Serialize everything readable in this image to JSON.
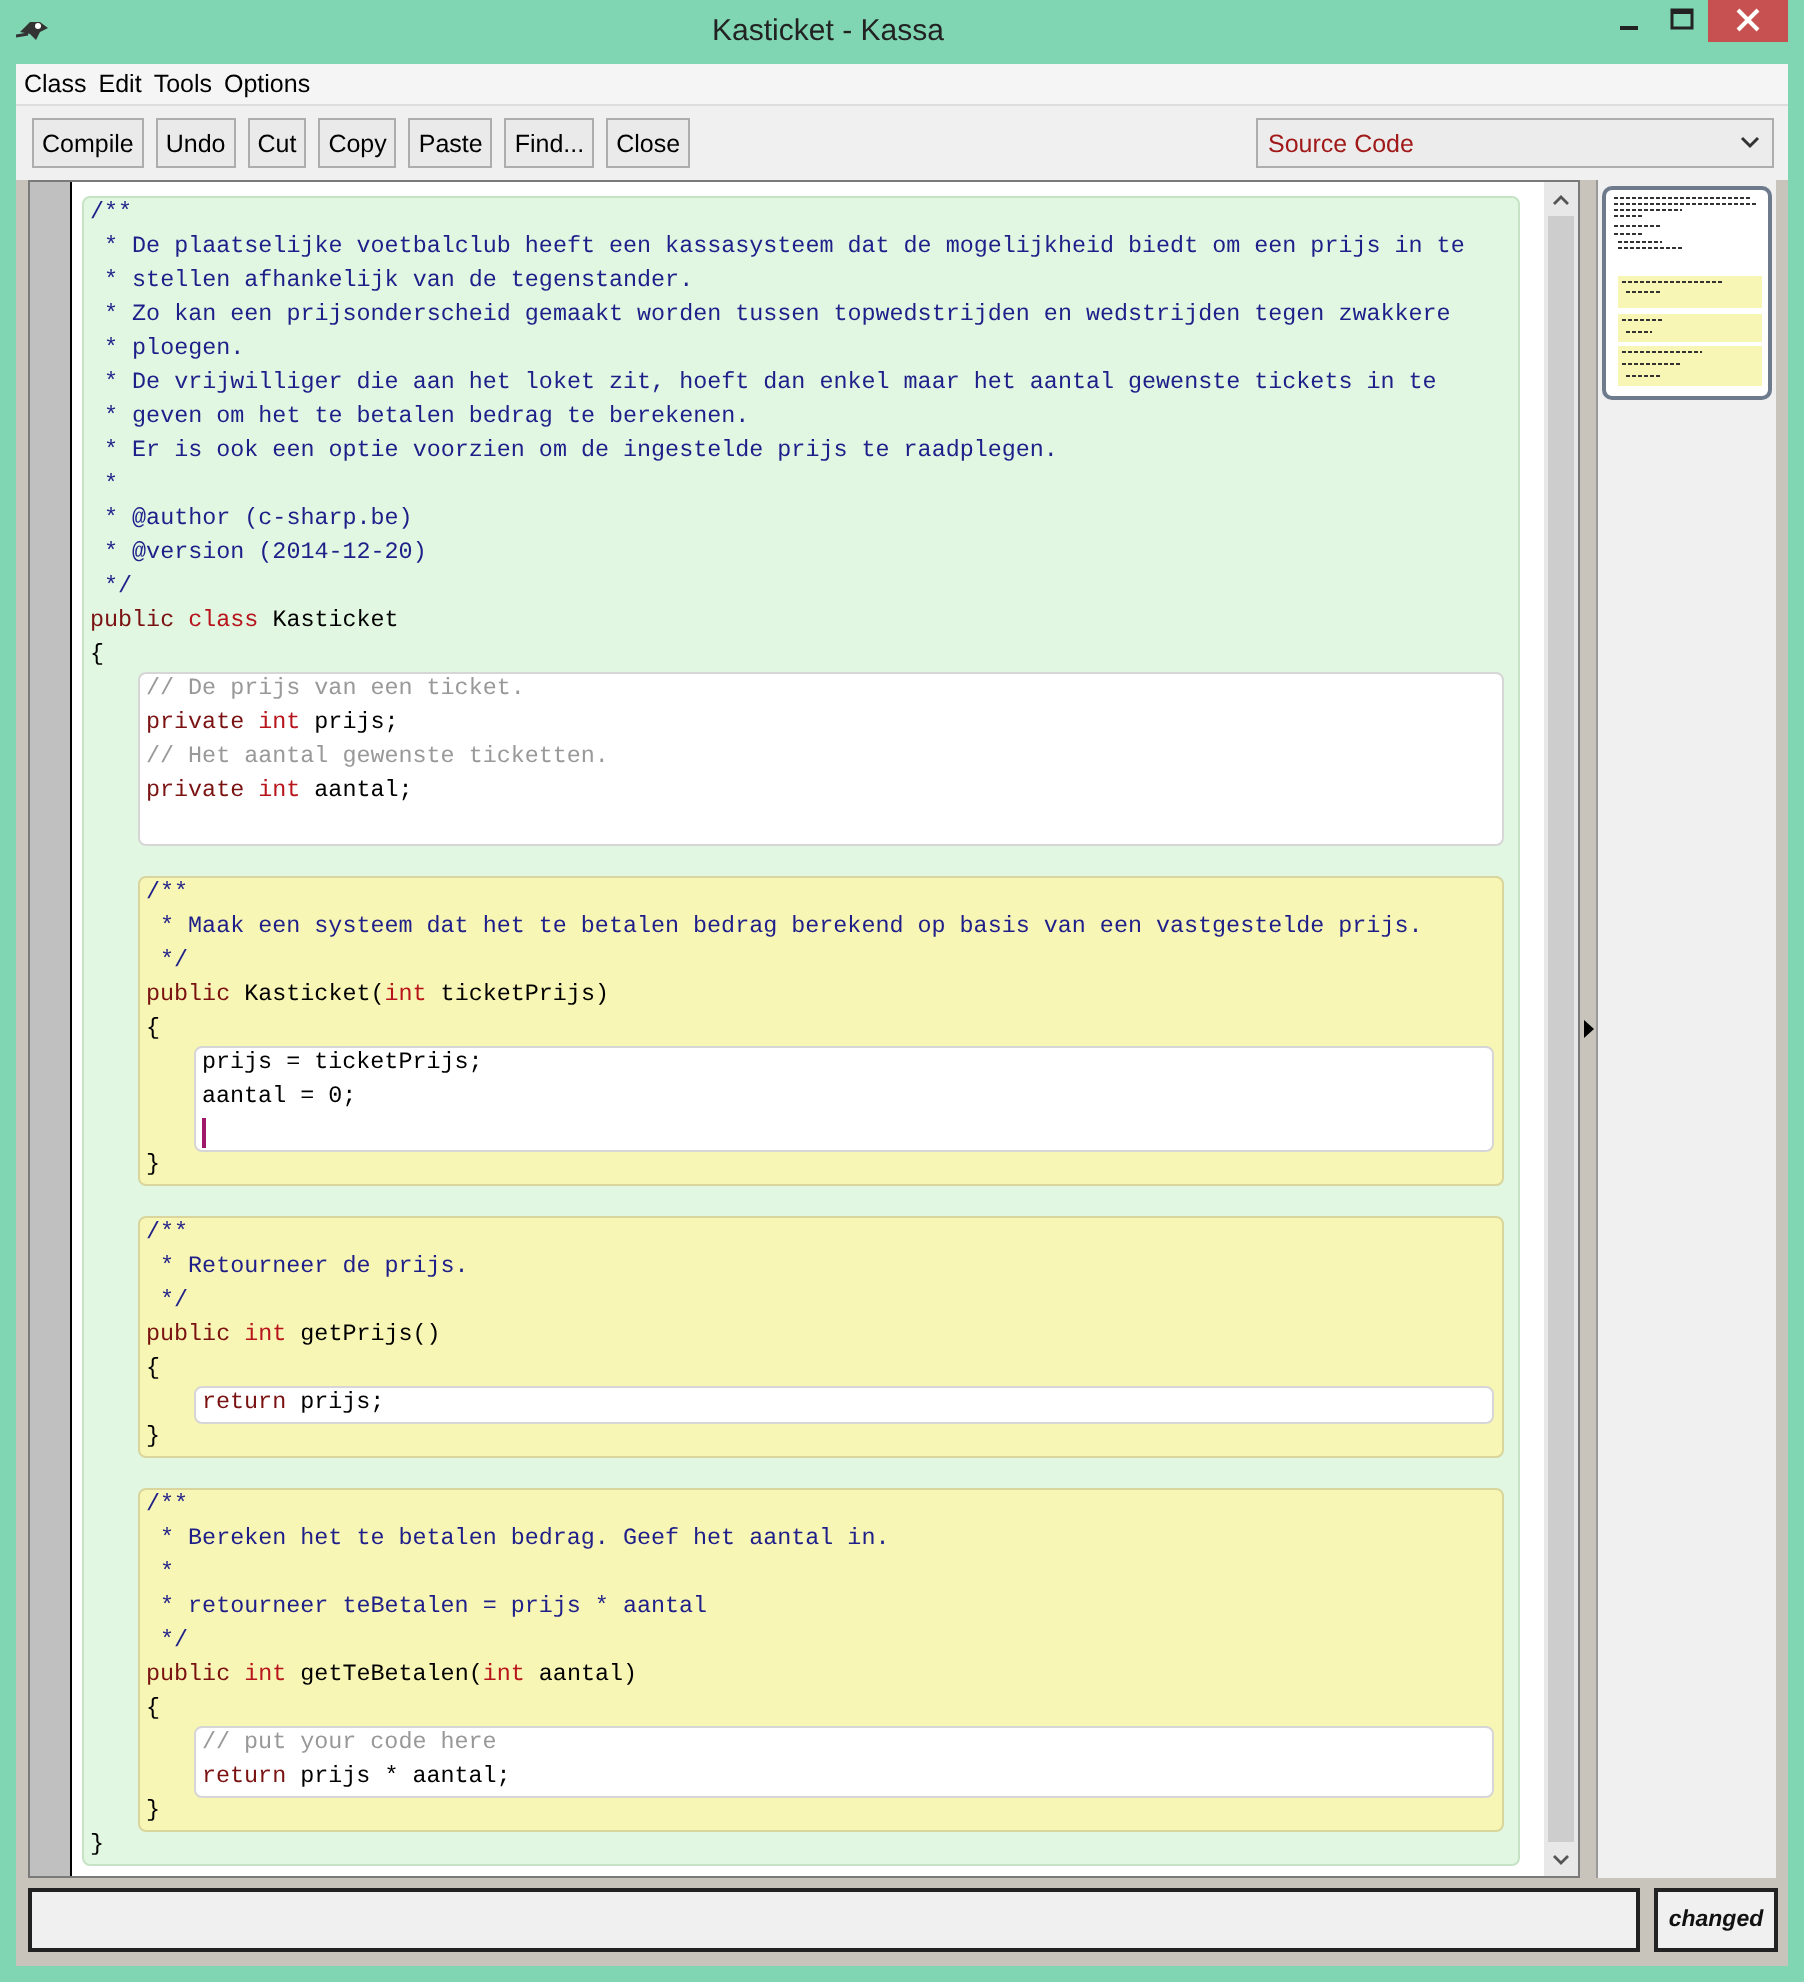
{
  "window": {
    "title": "Kasticket - Kassa"
  },
  "menu": [
    "Class",
    "Edit",
    "Tools",
    "Options"
  ],
  "toolbar": {
    "buttons": [
      "Compile",
      "Undo",
      "Cut",
      "Copy",
      "Paste",
      "Find...",
      "Close"
    ],
    "view_select": "Source Code"
  },
  "editor": {
    "scope": {
      "kind": "class",
      "items": [
        {
          "kind": "line",
          "tokens": [
            {
              "kind": "doc",
              "text": "/**"
            }
          ]
        },
        {
          "kind": "line",
          "tokens": [
            {
              "kind": "doc",
              "text": " * De plaatselijke voetbalclub heeft een kassasysteem dat de mogelijkheid biedt om een prijs in te"
            }
          ]
        },
        {
          "kind": "line",
          "tokens": [
            {
              "kind": "doc",
              "text": " * stellen afhankelijk van de tegenstander."
            }
          ]
        },
        {
          "kind": "line",
          "tokens": [
            {
              "kind": "doc",
              "text": " * Zo kan een prijsonderscheid gemaakt worden tussen topwedstrijden en wedstrijden tegen zwakkere"
            }
          ]
        },
        {
          "kind": "line",
          "tokens": [
            {
              "kind": "doc",
              "text": " * ploegen."
            }
          ]
        },
        {
          "kind": "line",
          "tokens": [
            {
              "kind": "doc",
              "text": " * De vrijwilliger die aan het loket zit, hoeft dan enkel maar het aantal gewenste tickets in te"
            }
          ]
        },
        {
          "kind": "line",
          "tokens": [
            {
              "kind": "doc",
              "text": " * geven om het te betalen bedrag te berekenen."
            }
          ]
        },
        {
          "kind": "line",
          "tokens": [
            {
              "kind": "doc",
              "text": " * Er is ook een optie voorzien om de ingestelde prijs te raadplegen."
            }
          ]
        },
        {
          "kind": "line",
          "tokens": [
            {
              "kind": "doc",
              "text": " *"
            }
          ]
        },
        {
          "kind": "line",
          "tokens": [
            {
              "kind": "doc",
              "text": " * @author (c-sharp.be)"
            }
          ]
        },
        {
          "kind": "line",
          "tokens": [
            {
              "kind": "doc",
              "text": " * @version (2014-12-20)"
            }
          ]
        },
        {
          "kind": "line",
          "tokens": [
            {
              "kind": "doc",
              "text": " */"
            }
          ]
        },
        {
          "kind": "line",
          "tokens": [
            {
              "kind": "keyword",
              "text": "public "
            },
            {
              "kind": "type",
              "text": "class"
            },
            {
              "kind": "plain",
              "text": " Kasticket"
            }
          ]
        },
        {
          "kind": "line",
          "tokens": [
            {
              "kind": "plain",
              "text": "{"
            }
          ]
        },
        {
          "kind": "fields",
          "items": [
            {
              "kind": "line",
              "tokens": [
                {
                  "kind": "comment",
                  "text": "// De prijs van een ticket."
                }
              ]
            },
            {
              "kind": "line",
              "tokens": [
                {
                  "kind": "keyword",
                  "text": "private "
                },
                {
                  "kind": "type",
                  "text": "int"
                },
                {
                  "kind": "plain",
                  "text": " prijs;"
                }
              ]
            },
            {
              "kind": "line",
              "tokens": [
                {
                  "kind": "comment",
                  "text": "// Het aantal gewenste ticketten."
                }
              ]
            },
            {
              "kind": "line",
              "tokens": [
                {
                  "kind": "keyword",
                  "text": "private "
                },
                {
                  "kind": "type",
                  "text": "int"
                },
                {
                  "kind": "plain",
                  "text": " aantal;"
                }
              ]
            },
            {
              "kind": "blank",
              "caret": false
            }
          ]
        },
        {
          "kind": "blank",
          "caret": false
        },
        {
          "kind": "method",
          "items": [
            {
              "kind": "line",
              "tokens": [
                {
                  "kind": "doc",
                  "text": "/**"
                }
              ]
            },
            {
              "kind": "line",
              "tokens": [
                {
                  "kind": "doc",
                  "text": " * Maak een systeem dat het te betalen bedrag berekend op basis van een vastgestelde prijs."
                }
              ]
            },
            {
              "kind": "line",
              "tokens": [
                {
                  "kind": "doc",
                  "text": " */"
                }
              ]
            },
            {
              "kind": "line",
              "tokens": [
                {
                  "kind": "keyword",
                  "text": "public"
                },
                {
                  "kind": "plain",
                  "text": " Kasticket("
                },
                {
                  "kind": "type",
                  "text": "int"
                },
                {
                  "kind": "plain",
                  "text": " ticketPrijs)"
                }
              ]
            },
            {
              "kind": "line",
              "tokens": [
                {
                  "kind": "plain",
                  "text": "{"
                }
              ]
            },
            {
              "kind": "body",
              "items": [
                {
                  "kind": "line",
                  "tokens": [
                    {
                      "kind": "plain",
                      "text": "prijs = ticketPrijs;"
                    }
                  ]
                },
                {
                  "kind": "line",
                  "tokens": [
                    {
                      "kind": "plain",
                      "text": "aantal = 0;"
                    }
                  ]
                },
                {
                  "kind": "blank",
                  "caret": true
                }
              ]
            },
            {
              "kind": "line",
              "tokens": [
                {
                  "kind": "plain",
                  "text": "}"
                }
              ]
            }
          ]
        },
        {
          "kind": "blank",
          "caret": false
        },
        {
          "kind": "method",
          "items": [
            {
              "kind": "line",
              "tokens": [
                {
                  "kind": "doc",
                  "text": "/**"
                }
              ]
            },
            {
              "kind": "line",
              "tokens": [
                {
                  "kind": "doc",
                  "text": " * Retourneer de prijs."
                }
              ]
            },
            {
              "kind": "line",
              "tokens": [
                {
                  "kind": "doc",
                  "text": " */"
                }
              ]
            },
            {
              "kind": "line",
              "tokens": [
                {
                  "kind": "keyword",
                  "text": "public "
                },
                {
                  "kind": "type",
                  "text": "int"
                },
                {
                  "kind": "plain",
                  "text": " getPrijs()"
                }
              ]
            },
            {
              "kind": "line",
              "tokens": [
                {
                  "kind": "plain",
                  "text": "{"
                }
              ]
            },
            {
              "kind": "body",
              "items": [
                {
                  "kind": "line",
                  "tokens": [
                    {
                      "kind": "keyword",
                      "text": "return"
                    },
                    {
                      "kind": "plain",
                      "text": " prijs;"
                    }
                  ]
                }
              ]
            },
            {
              "kind": "line",
              "tokens": [
                {
                  "kind": "plain",
                  "text": "}"
                }
              ]
            }
          ]
        },
        {
          "kind": "blank",
          "caret": false
        },
        {
          "kind": "method",
          "items": [
            {
              "kind": "line",
              "tokens": [
                {
                  "kind": "doc",
                  "text": "/**"
                }
              ]
            },
            {
              "kind": "line",
              "tokens": [
                {
                  "kind": "doc",
                  "text": " * Bereken het te betalen bedrag. Geef het aantal in."
                }
              ]
            },
            {
              "kind": "line",
              "tokens": [
                {
                  "kind": "doc",
                  "text": " *"
                }
              ]
            },
            {
              "kind": "line",
              "tokens": [
                {
                  "kind": "doc",
                  "text": " * retourneer teBetalen = prijs * aantal"
                }
              ]
            },
            {
              "kind": "line",
              "tokens": [
                {
                  "kind": "doc",
                  "text": " */"
                }
              ]
            },
            {
              "kind": "line",
              "tokens": [
                {
                  "kind": "keyword",
                  "text": "public "
                },
                {
                  "kind": "type",
                  "text": "int"
                },
                {
                  "kind": "plain",
                  "text": " getTeBetalen("
                },
                {
                  "kind": "type",
                  "text": "int"
                },
                {
                  "kind": "plain",
                  "text": " aantal)"
                }
              ]
            },
            {
              "kind": "line",
              "tokens": [
                {
                  "kind": "plain",
                  "text": "{"
                }
              ]
            },
            {
              "kind": "body",
              "items": [
                {
                  "kind": "line",
                  "tokens": [
                    {
                      "kind": "comment",
                      "text": "// put your code here"
                    }
                  ]
                },
                {
                  "kind": "line",
                  "tokens": [
                    {
                      "kind": "keyword",
                      "text": "return"
                    },
                    {
                      "kind": "plain",
                      "text": " prijs * aantal;"
                    }
                  ]
                }
              ]
            },
            {
              "kind": "line",
              "tokens": [
                {
                  "kind": "plain",
                  "text": "}"
                }
              ]
            }
          ]
        },
        {
          "kind": "line",
          "tokens": [
            {
              "kind": "plain",
              "text": "}"
            }
          ]
        }
      ]
    }
  },
  "status": {
    "indicator": "changed"
  }
}
